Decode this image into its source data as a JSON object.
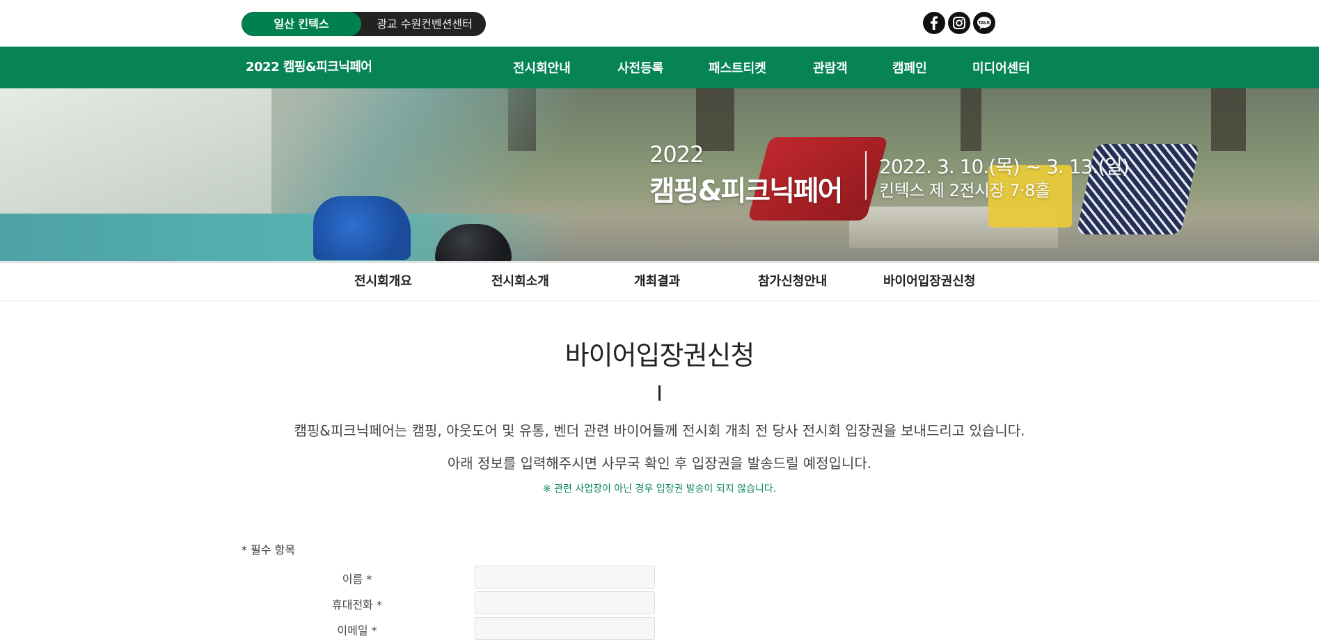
{
  "topbar": {
    "venue_active": "일산 킨텍스",
    "venue_other": "광교 수원컨벤션센터",
    "social": [
      "facebook-icon",
      "instagram-icon",
      "kakaotalk-icon"
    ],
    "kakao_label": "TALK"
  },
  "nav": {
    "brand": "2022 캠핑&피크닉페어",
    "items": [
      {
        "label": "전시회안내"
      },
      {
        "label": "사전등록"
      },
      {
        "label": "패스트티켓"
      },
      {
        "label": "관람객"
      },
      {
        "label": "캠페인"
      },
      {
        "label": "미디어센터"
      }
    ]
  },
  "banner": {
    "year": "2022",
    "title": "캠핑&피크닉페어",
    "dates": "2022. 3. 10.(목) ~ 3. 13.(일)",
    "place": "킨텍스 제 2전시장 7·8홀"
  },
  "subnav": {
    "items": [
      {
        "label": "전시회개요"
      },
      {
        "label": "전시회소개"
      },
      {
        "label": "개최결과"
      },
      {
        "label": "참가신청안내"
      },
      {
        "label": "바이어입장권신청"
      }
    ]
  },
  "main": {
    "title": "바이어입장권신청",
    "intro1": "캠핑&피크닉페어는 캠핑, 아웃도어 및 유통, 벤더 관련 바이어들께 전시회 개최 전 당사 전시회 입장권을 보내드리고 있습니다.",
    "intro2": "아래 정보를 입력해주시면 사무국 확인 후 입장권을 발송드릴 예정입니다.",
    "notice": "※ 관련 사업장이 아닌 경우 입장권 발송이 되지 않습니다.",
    "required_note": "* 필수 항목",
    "form": {
      "fields": [
        {
          "label": "이름 *",
          "value": ""
        },
        {
          "label": "휴대전화 *",
          "value": ""
        },
        {
          "label": "이메일 *",
          "value": ""
        }
      ]
    }
  },
  "colors": {
    "brand_green": "#068456",
    "dark": "#222222",
    "notice_green": "#068456"
  }
}
